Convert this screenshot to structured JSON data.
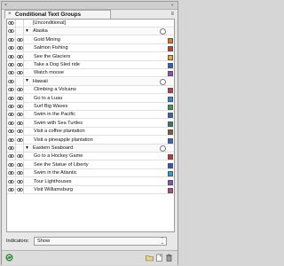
{
  "panel": {
    "tab_label": "Conditional Text Groups",
    "titlebar_close": "×",
    "titlebar_grip": "«",
    "tab_close": "×",
    "menu_glyph": "≡"
  },
  "rows": [
    {
      "kind": "condition",
      "label": "[Unconditional]",
      "indent": 0,
      "eye": true,
      "vis": false,
      "color": null
    },
    {
      "kind": "group",
      "label": "Alaska",
      "indent": 0,
      "eye": true,
      "vis": false,
      "color": null
    },
    {
      "kind": "condition",
      "label": "Gold Mining",
      "indent": 1,
      "eye": true,
      "vis": true,
      "color": "#e07a1f"
    },
    {
      "kind": "condition",
      "label": "Salmon Fishing",
      "indent": 1,
      "eye": true,
      "vis": true,
      "color": "#c6402e"
    },
    {
      "kind": "condition",
      "label": "See the Glaciers",
      "indent": 1,
      "eye": true,
      "vis": true,
      "color": "#e6b21c"
    },
    {
      "kind": "condition",
      "label": "Take a Dog Sled ride",
      "indent": 1,
      "eye": true,
      "vis": true,
      "color": "#2e60c6"
    },
    {
      "kind": "condition",
      "label": "Watch moose",
      "indent": 1,
      "eye": true,
      "vis": true,
      "color": "#9c45b8"
    },
    {
      "kind": "group",
      "label": "Hawaii",
      "indent": 0,
      "eye": true,
      "vis": false,
      "color": null
    },
    {
      "kind": "condition",
      "label": "Climbing a Volcano",
      "indent": 1,
      "eye": true,
      "vis": true,
      "color": "#c23a4a"
    },
    {
      "kind": "condition",
      "label": "Go to a Luau",
      "indent": 1,
      "eye": true,
      "vis": true,
      "color": "#2b8bd0"
    },
    {
      "kind": "condition",
      "label": "Surf Big Waves",
      "indent": 1,
      "eye": true,
      "vis": true,
      "color": "#3c9b45"
    },
    {
      "kind": "condition",
      "label": "Swim in the Pacific",
      "indent": 1,
      "eye": true,
      "vis": true,
      "color": "#3a5fc0"
    },
    {
      "kind": "condition",
      "label": "Swim with Sea Turtles",
      "indent": 1,
      "eye": true,
      "vis": true,
      "color": "#2f7c6e"
    },
    {
      "kind": "condition",
      "label": "Visit a coffee plantation",
      "indent": 1,
      "eye": true,
      "vis": true,
      "color": "#8a5a2d"
    },
    {
      "kind": "condition",
      "label": "Visit a pineapple plantation",
      "indent": 1,
      "eye": true,
      "vis": true,
      "color": "#2f66c5"
    },
    {
      "kind": "group",
      "label": "Eastern Seaboard",
      "indent": 0,
      "eye": true,
      "vis": false,
      "color": null
    },
    {
      "kind": "condition",
      "label": "Go to a Hockey Game",
      "indent": 1,
      "eye": true,
      "vis": true,
      "color": "#d03030"
    },
    {
      "kind": "condition",
      "label": "See the Statue of Liberty",
      "indent": 1,
      "eye": true,
      "vis": true,
      "color": "#2a56c6"
    },
    {
      "kind": "condition",
      "label": "Swim in the Atlantic",
      "indent": 1,
      "eye": true,
      "vis": true,
      "color": "#2a9fd0"
    },
    {
      "kind": "condition",
      "label": "Tour Lighthouses",
      "indent": 1,
      "eye": true,
      "vis": true,
      "color": "#8c49c4"
    },
    {
      "kind": "condition",
      "label": "Visit Williamsburg",
      "indent": 1,
      "eye": true,
      "vis": true,
      "color": "#c43d8c"
    }
  ],
  "indicators": {
    "label": "Indicators:",
    "value": "Show"
  },
  "icons": {
    "bottom": [
      "sync-icon",
      "new-folder-icon",
      "new-page-icon",
      "trash-icon"
    ]
  }
}
